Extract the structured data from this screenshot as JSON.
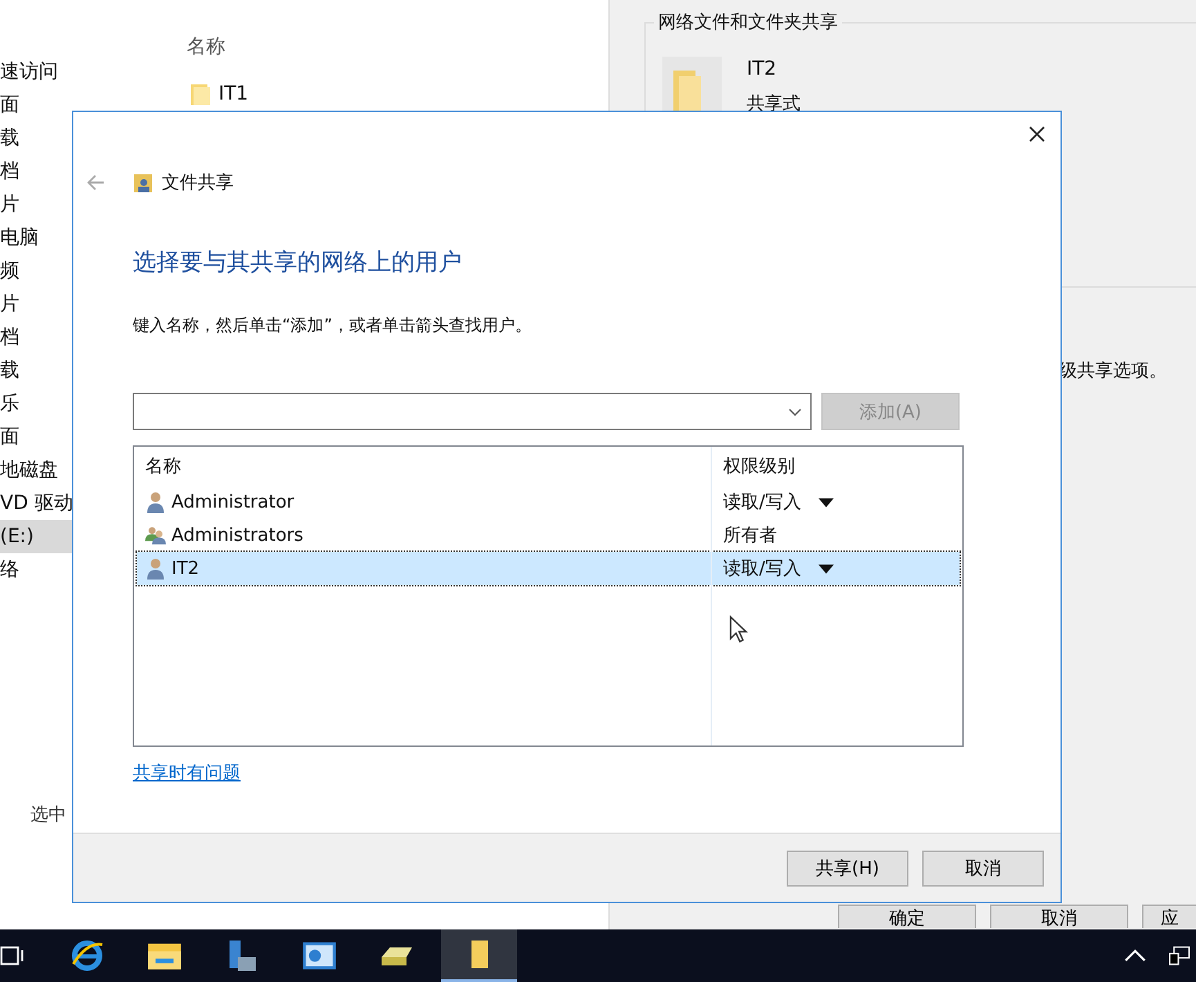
{
  "explorer": {
    "nav_items": [
      {
        "label": "速访问",
        "selected": false
      },
      {
        "label": "面",
        "selected": false
      },
      {
        "label": "载",
        "selected": false
      },
      {
        "label": "档",
        "selected": false
      },
      {
        "label": "片",
        "selected": false
      },
      {
        "label": "电脑",
        "selected": false
      },
      {
        "label": "频",
        "selected": false
      },
      {
        "label": "片",
        "selected": false
      },
      {
        "label": "档",
        "selected": false
      },
      {
        "label": "载",
        "selected": false
      },
      {
        "label": "乐",
        "selected": false
      },
      {
        "label": "面",
        "selected": false
      },
      {
        "label": "地磁盘",
        "selected": false
      },
      {
        "label": "VD 驱动",
        "selected": false
      },
      {
        "label": "(E:)",
        "selected": true
      },
      {
        "label": "络",
        "selected": false
      }
    ],
    "column_header": "名称",
    "items": [
      {
        "name": "IT1"
      }
    ],
    "status": "选中"
  },
  "properties": {
    "group_title": "网络文件和文件夹共享",
    "folder_name": "IT2",
    "folder_status": "共享式",
    "advanced_text": "级共享选项。",
    "buttons": [
      "确定",
      "取消",
      "应"
    ]
  },
  "dialog": {
    "title": "文件共享",
    "heading": "选择要与其共享的网络上的用户",
    "instruction": "键入名称，然后单击“添加”，或者单击箭头查找用户。",
    "add_button": {
      "label": "添加(A)",
      "disabled": true
    },
    "columns": [
      "名称",
      "权限级别"
    ],
    "rows": [
      {
        "name": "Administrator",
        "kind": "user",
        "permission": "读取/写入",
        "has_menu": true,
        "selected": false
      },
      {
        "name": "Administrators",
        "kind": "group",
        "permission": "所有者",
        "has_menu": false,
        "selected": false
      },
      {
        "name": "IT2",
        "kind": "user",
        "permission": "读取/写入",
        "has_menu": true,
        "selected": true
      }
    ],
    "help_link": "共享时有问题",
    "buttons": [
      "共享(H)",
      "取消"
    ]
  }
}
